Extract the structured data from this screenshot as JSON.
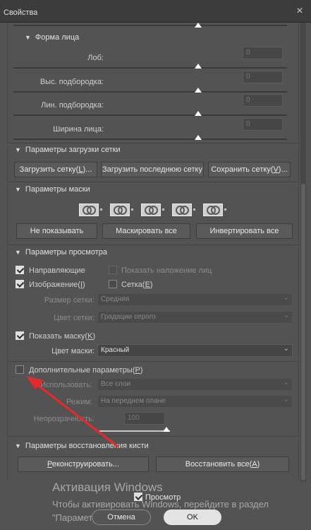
{
  "window": {
    "title": "Свойства",
    "close_glyph": "×"
  },
  "face_shape": {
    "title": "Форма лица",
    "rows": [
      {
        "label": "Лоб:",
        "value": "0"
      },
      {
        "label": "Выс. подбородка:",
        "value": "0"
      },
      {
        "label": "Лин. подбородка:",
        "value": "0"
      },
      {
        "label": "Ширина лица:",
        "value": "0"
      }
    ]
  },
  "mesh_load": {
    "title": "Параметры загрузки сетки",
    "buttons": [
      {
        "pre": "Загрузить сетку(",
        "key": "L",
        "post": ")..."
      },
      {
        "pre": "Загрузить последнюю сетку",
        "key": "",
        "post": ""
      },
      {
        "pre": "Сохранить сетку(",
        "key": "V",
        "post": ")..."
      }
    ]
  },
  "mask": {
    "title": "Параметры маски",
    "icons": [
      "mask-replace-icon",
      "mask-add-icon",
      "mask-subtract-icon",
      "mask-intersect-icon",
      "mask-invert-icon"
    ],
    "buttons": [
      "Не показывать",
      "Маскировать все",
      "Инвертировать все"
    ]
  },
  "view": {
    "title": "Параметры просмотра",
    "guides": {
      "label": "Направляющие",
      "checked": true
    },
    "face_overlay": {
      "label": "Показать наложение лиц",
      "checked": false,
      "disabled": true
    },
    "image": {
      "pre": "Изображение(",
      "key": "I",
      "post": ")",
      "checked": true
    },
    "mesh": {
      "pre": "Сетка(",
      "key": "E",
      "post": ")",
      "checked": false
    },
    "mesh_size": {
      "label": "Размер сетки:",
      "value": "Средняя"
    },
    "mesh_color": {
      "label": "Цвет сетки:",
      "value": "Градации серого"
    },
    "show_mask": {
      "pre": "Показать маску(",
      "key": "K",
      "post": ")",
      "checked": true
    },
    "mask_color": {
      "label": "Цвет маски:",
      "value": "Красный"
    },
    "extra": {
      "pre": "Дополнительные параметры(",
      "key": "P",
      "post": ")",
      "checked": false
    },
    "use": {
      "label": "Использовать:",
      "value": "Все слои"
    },
    "mode": {
      "label": "Режим:",
      "value": "На переднем плане"
    },
    "opacity": {
      "label": "Непрозрачность:",
      "value": "100"
    }
  },
  "brush_restore": {
    "title": "Параметры восстановления кисти",
    "reconstruct": {
      "pre": "",
      "key": "Р",
      "post": "еконструировать..."
    },
    "restore_all": {
      "pre": "Восстановить все(",
      "key": "A",
      "post": ")"
    }
  },
  "preview": {
    "label": "Просмотр",
    "checked": true
  },
  "footer": {
    "cancel": "Отмена",
    "ok": "OK"
  },
  "watermark": {
    "title": "Активация Windows",
    "line1": "Чтобы активировать Windows, перейдите в раздел",
    "line2": "\"Параметры\"."
  },
  "colors": {
    "background": "#535353",
    "arrow": "#e8282b",
    "titlebar": "#3c3c3c"
  }
}
